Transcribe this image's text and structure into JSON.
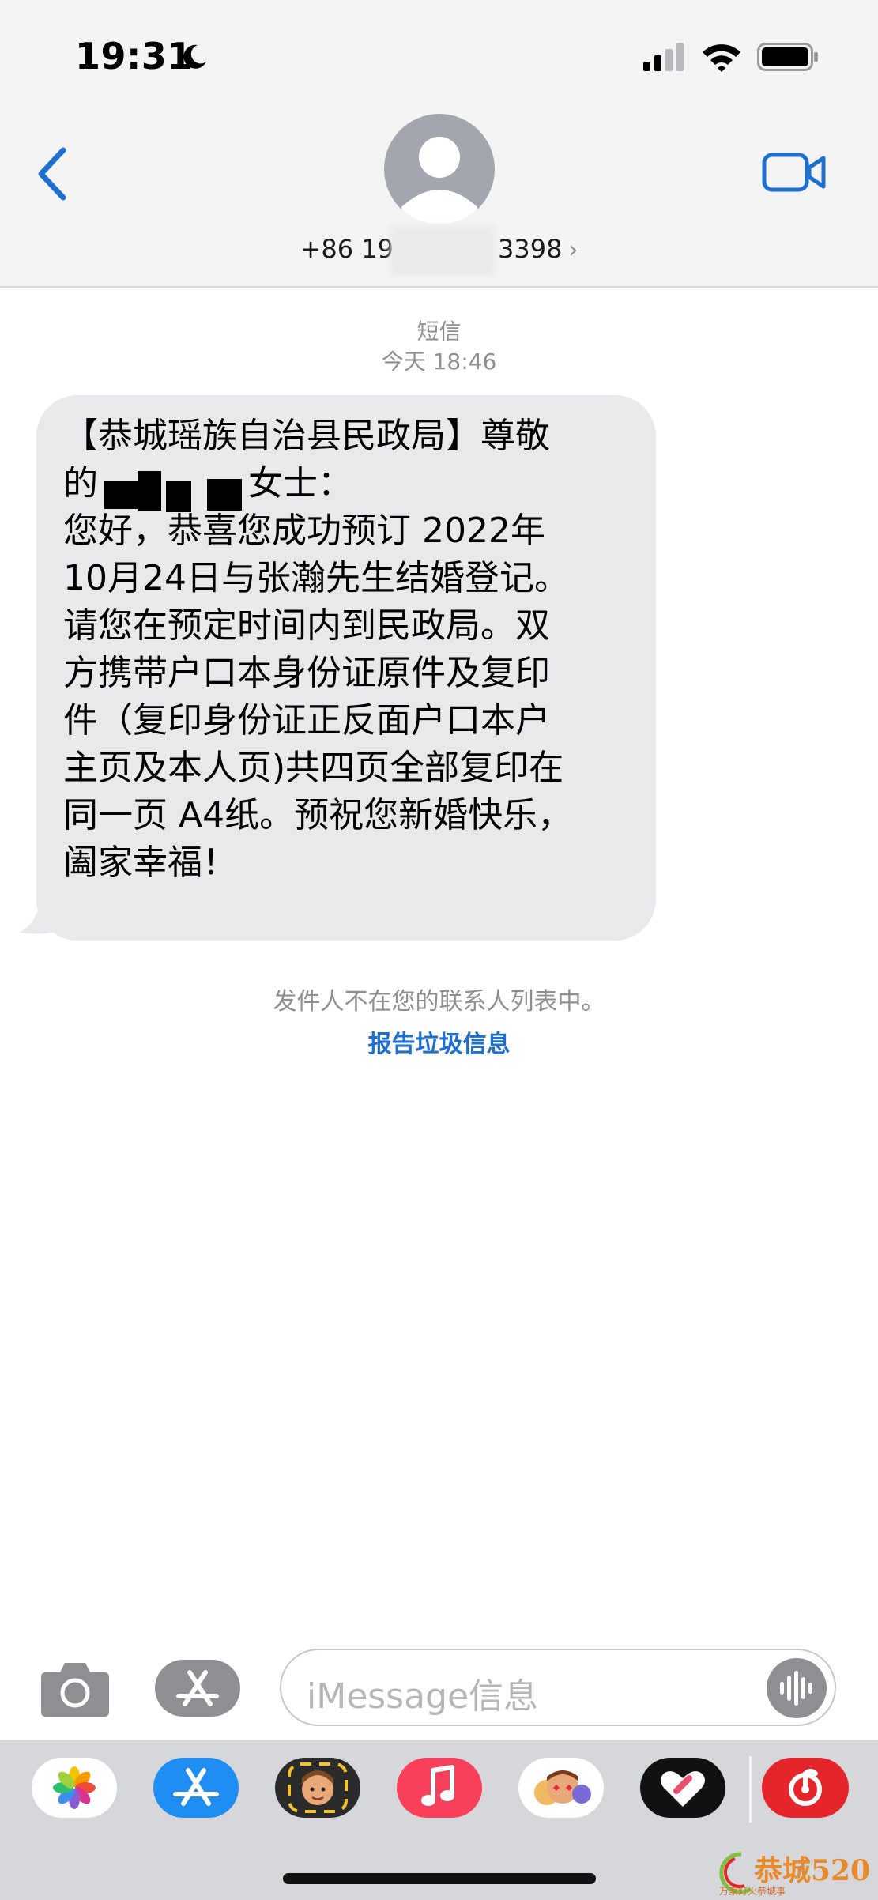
{
  "status_bar": {
    "time": "19:31"
  },
  "header": {
    "contact_number_prefix": "+86 19",
    "contact_number_suffix": "3398",
    "chevron": "›"
  },
  "conversation": {
    "service": "短信",
    "timestamp": "今天 18:46",
    "message_lines": [
      "【恭城瑶族自治县民政局】尊敬",
      "的",
      "您好，恭喜您成功预订 2022年",
      "10月24日与张瀚先生结婚登记。",
      "请您在预定时间内到民政局。双",
      "方携带户口本身份证原件及复印",
      "件（复印身份证正反面户口本户",
      "主页及本人页)共四页全部复印在",
      "同一页 A4纸。预祝您新婚快乐，",
      "阖家幸福！"
    ],
    "line2_suffix": "女士：",
    "sender_notice": "发件人不在您的联系人列表中。",
    "report_link": "报告垃圾信息"
  },
  "input": {
    "placeholder": "iMessage信息"
  },
  "watermark": {
    "text": "恭城520",
    "subtext": "万家灯火恭城事"
  },
  "colors": {
    "accent": "#1d6fd1",
    "bubble": "#e9e9eb",
    "tray": "#d6d7db"
  },
  "icons": [
    "back-chevron-icon",
    "video-camera-icon",
    "camera-icon",
    "app-store-icon",
    "audio-waveform-icon",
    "photos-icon",
    "memoji-icon",
    "music-icon",
    "heart-icon",
    "netease-music-icon"
  ]
}
